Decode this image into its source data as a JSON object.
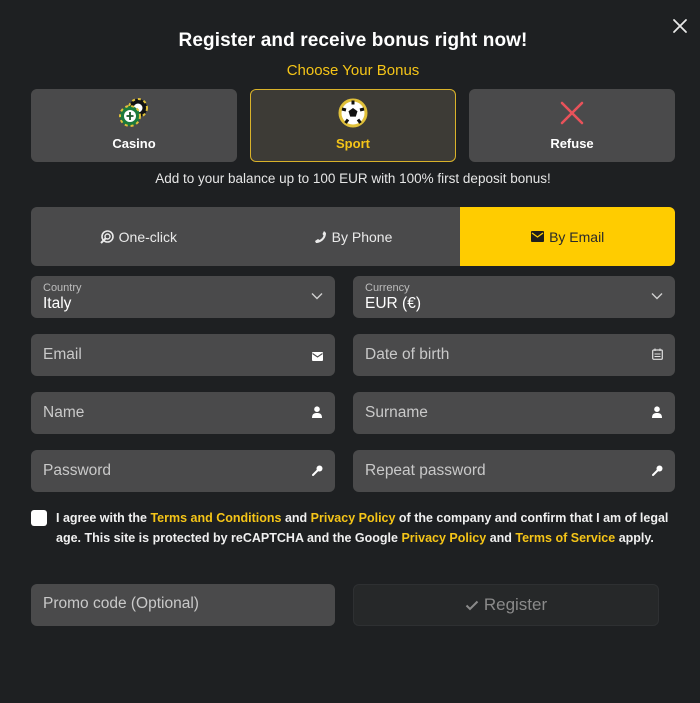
{
  "header": {
    "title": "Register and receive bonus right now!",
    "subtitle": "Choose Your Bonus",
    "close_icon": "close-icon"
  },
  "bonus": {
    "options": [
      {
        "label": "Casino",
        "icon": "casino-chips-icon",
        "selected": false
      },
      {
        "label": "Sport",
        "icon": "soccer-ball-icon",
        "selected": true
      },
      {
        "label": "Refuse",
        "icon": "red-x-icon",
        "selected": false
      }
    ],
    "description": "Add to your balance up to 100 EUR with 100% first deposit bonus!"
  },
  "tabs": [
    {
      "label": "One-click",
      "icon": "one-click-icon",
      "active": false
    },
    {
      "label": "By Phone",
      "icon": "phone-icon",
      "active": false
    },
    {
      "label": "By Email",
      "icon": "envelope-icon",
      "active": true
    }
  ],
  "form": {
    "country": {
      "label": "Country",
      "value": "Italy"
    },
    "currency": {
      "label": "Currency",
      "value": "EUR (€)"
    },
    "email": {
      "placeholder": "Email",
      "value": ""
    },
    "date_of_birth": {
      "placeholder": "Date of birth",
      "value": ""
    },
    "name": {
      "placeholder": "Name",
      "value": ""
    },
    "surname": {
      "placeholder": "Surname",
      "value": ""
    },
    "password": {
      "placeholder": "Password",
      "value": ""
    },
    "repeat_password": {
      "placeholder": "Repeat password",
      "value": ""
    },
    "promo_code": {
      "placeholder": "Promo code (Optional)",
      "value": ""
    }
  },
  "agreement": {
    "checked": false,
    "t1": "I agree with the ",
    "link_terms": "Terms and Conditions",
    "t2": " and ",
    "link_privacy": "Privacy Policy",
    "t3": " of the company and confirm that I am of legal age. This site is protected by reCAPTCHA and the Google ",
    "link_google_privacy": "Privacy Policy",
    "t4": " and ",
    "link_tos": "Terms of Service",
    "t5": " apply."
  },
  "actions": {
    "register_label": "Register"
  },
  "colors": {
    "accent": "#ffcc00",
    "link": "#f5c518",
    "background": "#1e2022",
    "field": "#4a4a4b"
  }
}
